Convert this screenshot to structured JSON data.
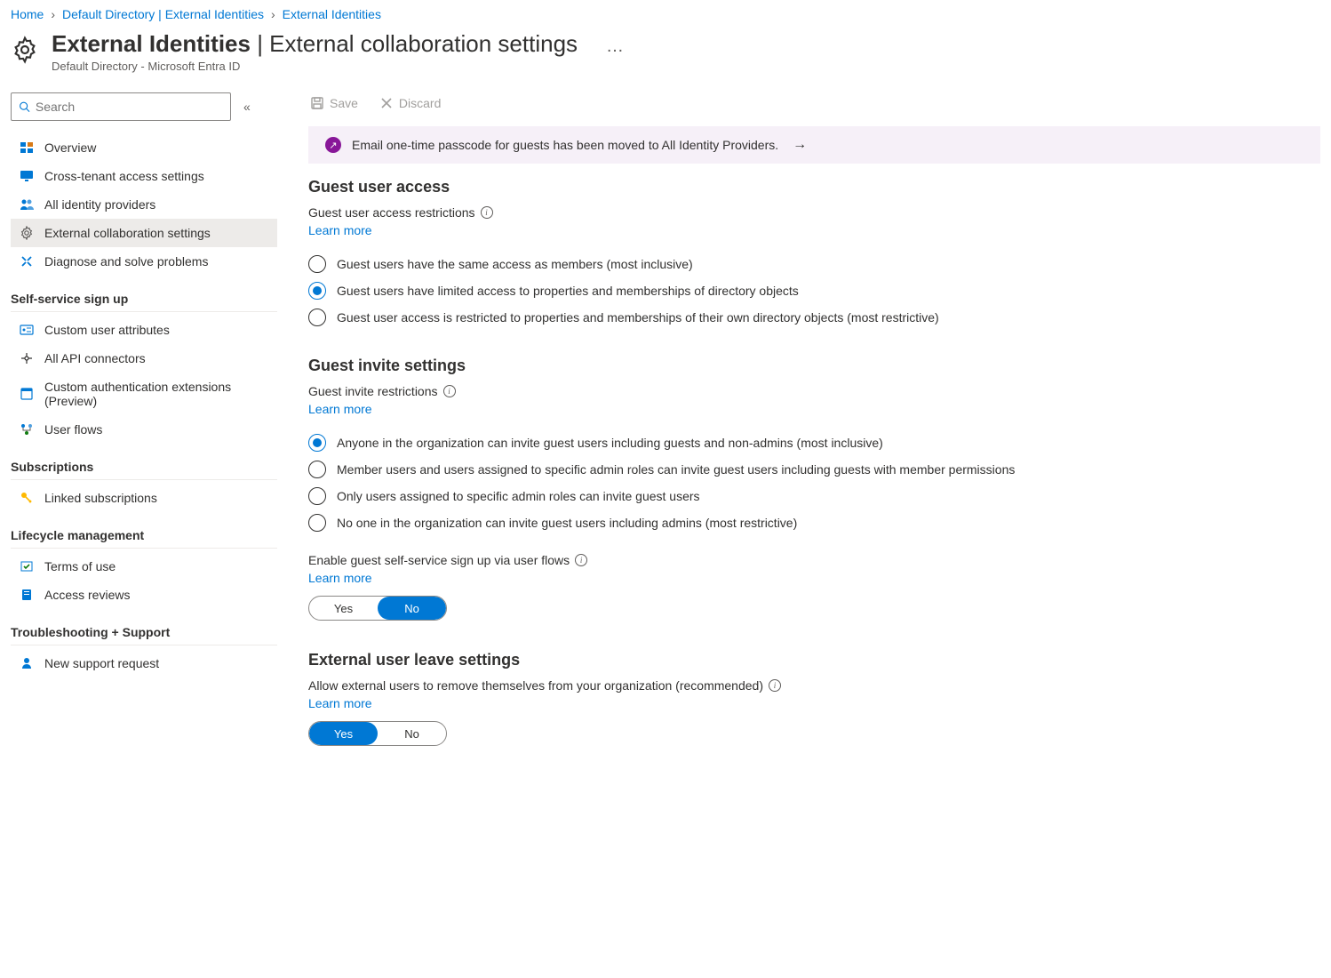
{
  "breadcrumb": {
    "home": "Home",
    "dir": "Default Directory | External Identities",
    "current": "External Identities"
  },
  "header": {
    "title_main": "External Identities",
    "title_sep": " | ",
    "title_sub": "External collaboration settings",
    "subtitle": "Default Directory - Microsoft Entra ID"
  },
  "search": {
    "placeholder": "Search"
  },
  "sidebar": {
    "items_top": [
      {
        "label": "Overview",
        "icon": "overview-icon"
      },
      {
        "label": "Cross-tenant access settings",
        "icon": "monitor-icon"
      },
      {
        "label": "All identity providers",
        "icon": "people-icon"
      },
      {
        "label": "External collaboration settings",
        "icon": "gear-icon",
        "active": true
      },
      {
        "label": "Diagnose and solve problems",
        "icon": "wrench-icon"
      }
    ],
    "group_self_service": {
      "title": "Self-service sign up",
      "items": [
        {
          "label": "Custom user attributes",
          "icon": "card-icon"
        },
        {
          "label": "All API connectors",
          "icon": "connector-icon"
        },
        {
          "label": "Custom authentication extensions (Preview)",
          "icon": "window-icon"
        },
        {
          "label": "User flows",
          "icon": "flow-icon"
        }
      ]
    },
    "group_subscriptions": {
      "title": "Subscriptions",
      "items": [
        {
          "label": "Linked subscriptions",
          "icon": "key-icon"
        }
      ]
    },
    "group_lifecycle": {
      "title": "Lifecycle management",
      "items": [
        {
          "label": "Terms of use",
          "icon": "check-icon"
        },
        {
          "label": "Access reviews",
          "icon": "book-icon"
        }
      ]
    },
    "group_troubleshoot": {
      "title": "Troubleshooting + Support",
      "items": [
        {
          "label": "New support request",
          "icon": "support-icon"
        }
      ]
    }
  },
  "toolbar": {
    "save": "Save",
    "discard": "Discard"
  },
  "banner": {
    "text": "Email one-time passcode for guests has been moved to All Identity Providers."
  },
  "sections": {
    "guest_access": {
      "title": "Guest user access",
      "label": "Guest user access restrictions",
      "learn_more": "Learn more",
      "options": [
        "Guest users have the same access as members (most inclusive)",
        "Guest users have limited access to properties and memberships of directory objects",
        "Guest user access is restricted to properties and memberships of their own directory objects (most restrictive)"
      ],
      "selected": 1
    },
    "guest_invite": {
      "title": "Guest invite settings",
      "label": "Guest invite restrictions",
      "learn_more": "Learn more",
      "options": [
        "Anyone in the organization can invite guest users including guests and non-admins (most inclusive)",
        "Member users and users assigned to specific admin roles can invite guest users including guests with member permissions",
        "Only users assigned to specific admin roles can invite guest users",
        "No one in the organization can invite guest users including admins (most restrictive)"
      ],
      "selected": 0,
      "self_service_label": "Enable guest self-service sign up via user flows",
      "self_service_learn_more": "Learn more",
      "toggle": {
        "yes": "Yes",
        "no": "No",
        "value": "No"
      }
    },
    "external_leave": {
      "title": "External user leave settings",
      "label": "Allow external users to remove themselves from your organization (recommended)",
      "learn_more": "Learn more",
      "toggle": {
        "yes": "Yes",
        "no": "No",
        "value": "Yes"
      }
    }
  }
}
